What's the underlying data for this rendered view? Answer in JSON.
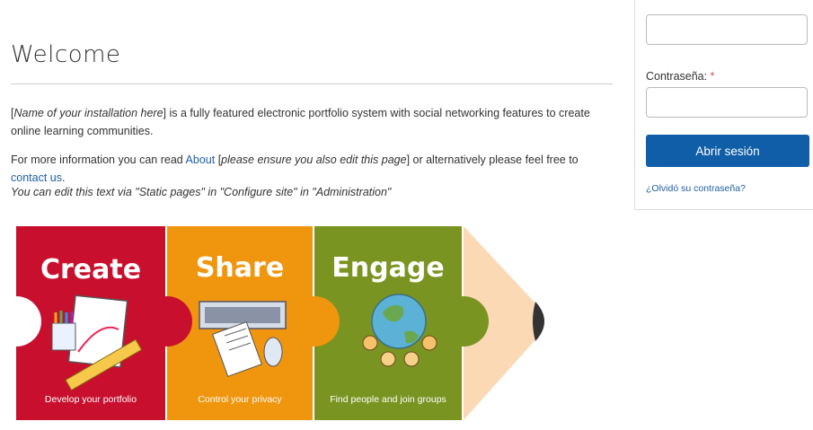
{
  "main": {
    "title": "Welcome",
    "p1": {
      "italic_name": "Name of your installation here",
      "rest": "] is a fully featured electronic portfolio system with social networking features to create online learning communities."
    },
    "p2": {
      "pre": "For more information you can read ",
      "about_link": "About",
      "mid_open": " [",
      "italic": "please ensure you also edit this page",
      "mid_close": "] or alternatively please feel free to ",
      "contact_link": "contact us",
      "end": "."
    },
    "p3": "You can edit this text via \"Static pages\" in \"Configure site\" in \"Administration\""
  },
  "banner": {
    "pieces": [
      {
        "title": "Create",
        "caption": "Develop your portfolio",
        "color": "#c8102e"
      },
      {
        "title": "Share",
        "caption": "Control your privacy",
        "color": "#f0960e"
      },
      {
        "title": "Engage",
        "caption": "Find people and join groups",
        "color": "#7a9422"
      }
    ],
    "tip_color": "#fbd9b5"
  },
  "login": {
    "password_label": "Contraseña:",
    "required_mark": "*",
    "submit_label": "Abrir sesión",
    "forgot_link": "¿Olvidó su contraseña?"
  }
}
